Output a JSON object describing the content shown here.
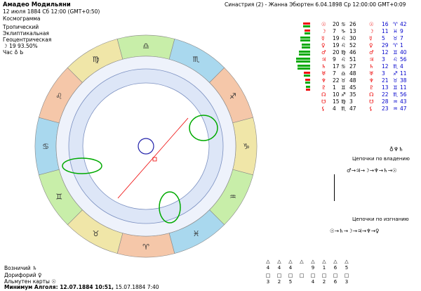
{
  "header": {
    "name": "Амадео Модильяни",
    "date_line": "12 июля 1884  Сб  12:00 (GMT+0:50)",
    "kind": "Космограмма",
    "opt1": "Тропический",
    "opt2": "Эклиптикальная",
    "opt3": "Геоцентрическая",
    "moon_phase": "☽  19 93.50%",
    "hour": "Час ♁ Ь"
  },
  "synastry": "Синастрия (2) - Жанна Эбюртен  6.04.1898  Ср 12:00:00 GMT+0:09",
  "planets": [
    {
      "g1": "☉",
      "d1": "20",
      "g2": "♋",
      "m1": "26",
      "g3": "☉",
      "d2": "16",
      "s2": "♈",
      "m2": "42",
      "bar": "#e00",
      "bar2": "#0a0",
      "bw": 10
    },
    {
      "g1": "☽",
      "d1": "7",
      "g2": "♑",
      "m1": "13",
      "g3": "☽",
      "d2": "11",
      "s2": "♓",
      "m2": "9",
      "bar": "#e00",
      "bar2": "#0a0",
      "bw": 8
    },
    {
      "g1": "☿",
      "d1": "19",
      "g2": "♌",
      "m1": "30",
      "g3": "☿",
      "d2": "5",
      "s2": "♉",
      "m2": "7",
      "bar": "#0a0",
      "bar2": "#0a0",
      "bw": 14
    },
    {
      "g1": "♀",
      "d1": "19",
      "g2": "♌",
      "m1": "52",
      "g3": "♀",
      "d2": "29",
      "s2": "♈",
      "m2": "1",
      "bar": "#0a0",
      "bar2": "#0a0",
      "bw": 12
    },
    {
      "g1": "♂",
      "d1": "20",
      "g2": "♍",
      "m1": "46",
      "g3": "♂",
      "d2": "12",
      "s2": "♊",
      "m2": "40",
      "bar": "#0a0",
      "bar2": "#0a0",
      "bw": 16
    },
    {
      "g1": "♃",
      "d1": "9",
      "g2": "♌",
      "m1": "51",
      "g3": "♃",
      "d2": "3",
      "s2": "♌",
      "m2": "56",
      "bar": "#0a0",
      "bar2": "#0a0",
      "bw": 20
    },
    {
      "g1": "♄",
      "d1": "17",
      "g2": "♋",
      "m1": "27",
      "g3": "♄",
      "d2": "12",
      "s2": "♏",
      "m2": "4",
      "bar": "#0a0",
      "bar2": "#0a0",
      "bw": 18
    },
    {
      "g1": "♅",
      "d1": "7",
      "g2": "♎",
      "m1": "48",
      "g3": "♅",
      "d2": "3",
      "s2": "♐",
      "m2": "11",
      "bar": "#e00",
      "bar2": "#0a0",
      "bw": 9
    },
    {
      "g1": "♆",
      "d1": "22",
      "g2": "♉",
      "m1": "48",
      "g3": "♆",
      "d2": "21",
      "s2": "♉",
      "m2": "38",
      "bar": "#e00",
      "bar2": "#0a0",
      "bw": 7
    },
    {
      "g1": "♇",
      "d1": "1",
      "g2": "♊",
      "m1": "45",
      "g3": "♇",
      "d2": "13",
      "s2": "♊",
      "m2": "11",
      "bar": "#0a0",
      "bar2": "#e00",
      "bw": 6
    },
    {
      "g1": "☊",
      "d1": "10",
      "g2": "♐",
      "m1": "35",
      "g3": "☊",
      "d2": "22",
      "s2": "♏",
      "m2": "56",
      "bar": "",
      "bar2": "",
      "bw": 0
    },
    {
      "g1": "☋",
      "d1": "15",
      "g2": "♍",
      "m1": "3",
      "g3": "☋",
      "d2": "28",
      "s2": "♒",
      "m2": "43",
      "bar": "",
      "bar2": "",
      "bw": 0
    },
    {
      "g1": "⚸",
      "d1": "4",
      "g2": "♏",
      "m1": "47",
      "g3": "⚸",
      "d2": "23",
      "s2": "♒",
      "m2": "47",
      "bar": "",
      "bar2": "",
      "bw": 0
    }
  ],
  "chains": {
    "top_glyphs": "♁♆♄",
    "rulership_title": "Цепочки по владению",
    "rulership": "♂→♃→☽→♆→♄→☉",
    "exile_title": "Цепочки по изгнанию",
    "exile": "☉→♄→☽→♃→♆→♀"
  },
  "bottom": {
    "vozn": "Возничий",
    "dorif": "Дорифорий",
    "alm": "Альмутен карты",
    "vozn_g": "♄",
    "dorif_g": "♀",
    "alm_g": "☉",
    "minimum_label": "Минимум Алголя: 12.07.1884 10:51,",
    "minimum_rest": "15.07.1884  7:40"
  },
  "aspect_grid": {
    "top": [
      "4",
      "4",
      "4",
      "",
      "9",
      "1",
      "6",
      "5"
    ],
    "bottom": [
      "3",
      "2",
      "5",
      "",
      "4",
      "2",
      "6",
      "3"
    ]
  },
  "wheel": {
    "signs": [
      "♈",
      "♉",
      "♊",
      "♋",
      "♌",
      "♍",
      "♎",
      "♏",
      "♐",
      "♑",
      "♒",
      "♓"
    ],
    "colors": [
      "#f5c7a9",
      "#f0e6a8",
      "#c8eea9",
      "#a9d8ee",
      "#f5c7a9",
      "#f0e6a8",
      "#c8eea9",
      "#a9d8ee",
      "#f5c7a9",
      "#f0e6a8",
      "#c8eea9",
      "#a9d8ee"
    ]
  }
}
